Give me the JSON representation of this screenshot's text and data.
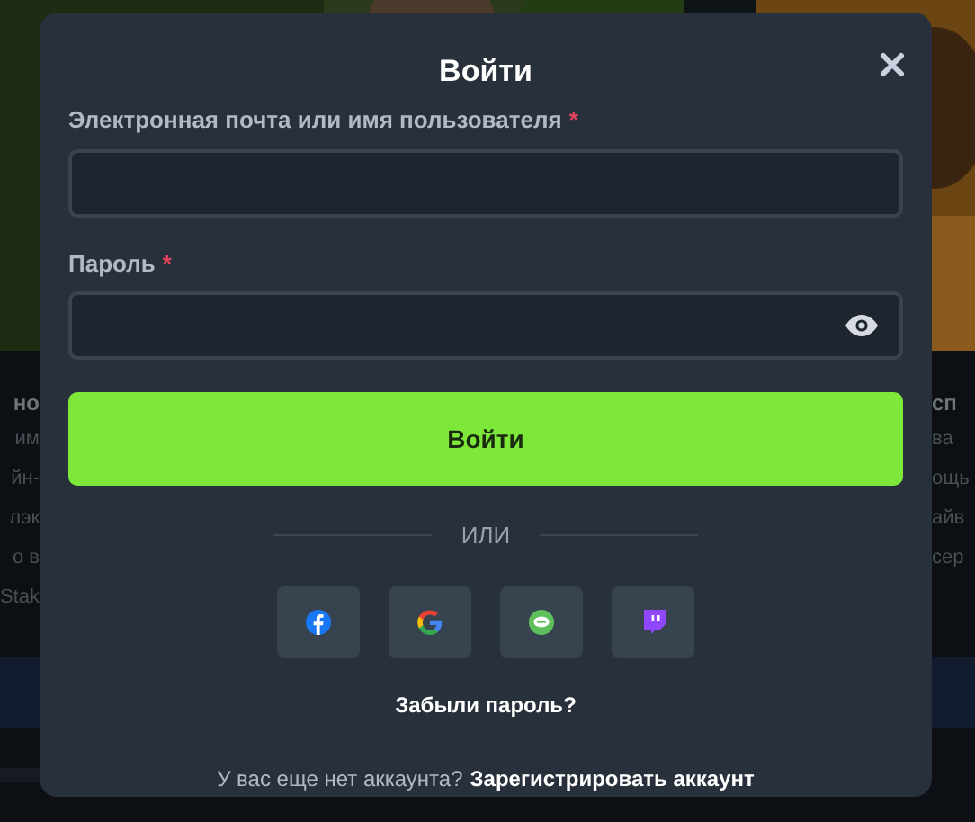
{
  "background": {
    "left_column": {
      "heading": "но",
      "lines": [
        "им",
        "йн-",
        "лэк",
        "о в",
        "Stak"
      ]
    },
    "right_column": {
      "heading": "сп",
      "lines": [
        "ва",
        "ощь",
        "айв",
        "сер"
      ]
    }
  },
  "modal": {
    "title": "Войти",
    "fields": [
      {
        "kind": "text",
        "label": "Электронная почта или имя пользователя",
        "required_mark": "*"
      },
      {
        "kind": "password",
        "label": "Пароль",
        "required_mark": "*"
      }
    ],
    "submit": "Войти",
    "divider": "ИЛИ",
    "social": [
      {
        "kind": "facebook"
      },
      {
        "kind": "google"
      },
      {
        "kind": "line"
      },
      {
        "kind": "twitch"
      }
    ],
    "forgot": "Забыли пароль?",
    "signup": {
      "text": "У вас еще нет аккаунта?",
      "link": "Зарегистрировать аккаунт"
    }
  }
}
